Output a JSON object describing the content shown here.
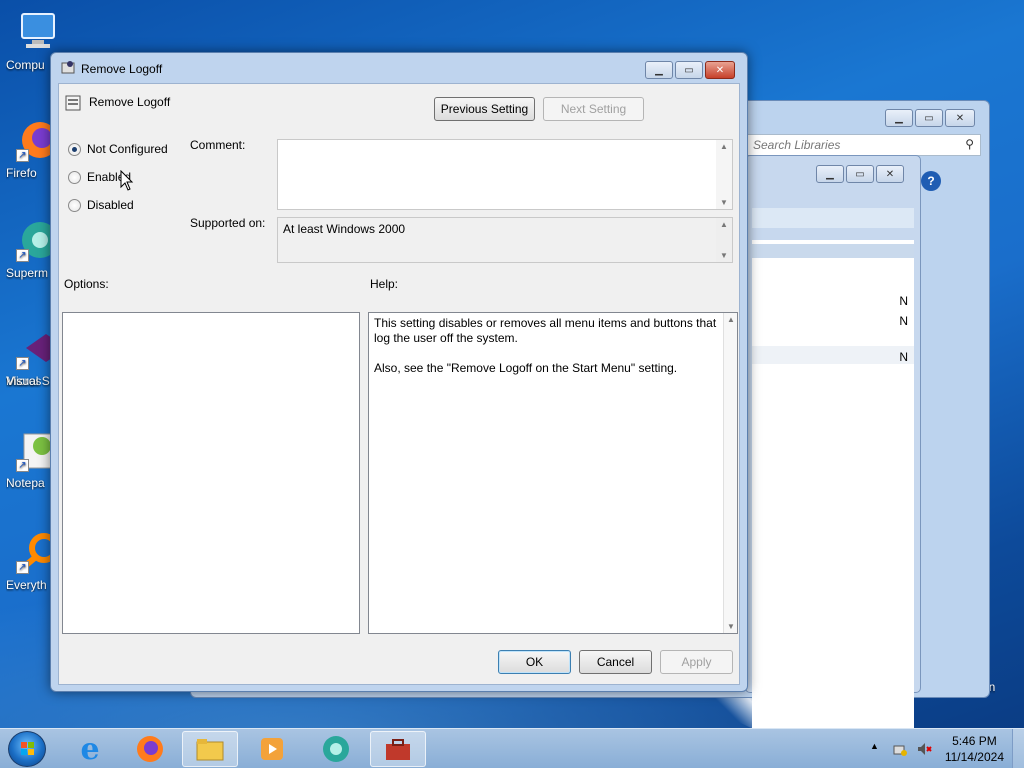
{
  "desktop": {
    "icons": [
      {
        "label": "Compu"
      },
      {
        "label": "Firefo"
      },
      {
        "label": "Superm"
      },
      {
        "label": "Micros"
      },
      {
        "label": "Visual St"
      },
      {
        "label": "Notepa"
      },
      {
        "label": "Everyth"
      }
    ],
    "recycle_bin_partial": "Bin"
  },
  "background_window": {
    "search_placeholder": "Search Libraries",
    "list_letters": [
      "N",
      "N",
      "N"
    ]
  },
  "dialog": {
    "title": "Remove Logoff",
    "header_title": "Remove Logoff",
    "previous_setting": "Previous Setting",
    "next_setting": "Next Setting",
    "radio": {
      "not_configured": "Not Configured",
      "enabled": "Enabled",
      "disabled": "Disabled",
      "selected": "not_configured"
    },
    "comment_label": "Comment:",
    "comment_value": "",
    "supported_on_label": "Supported on:",
    "supported_on_value": "At least Windows 2000",
    "options_label": "Options:",
    "help_label": "Help:",
    "help_text_1": "This setting disables or removes all menu items and buttons that log the user off the system.",
    "help_text_2": "Also, see the \"Remove Logoff on the Start Menu\" setting.",
    "ok": "OK",
    "cancel": "Cancel",
    "apply": "Apply"
  },
  "taskbar": {
    "time": "5:46 PM",
    "date": "11/14/2024"
  }
}
